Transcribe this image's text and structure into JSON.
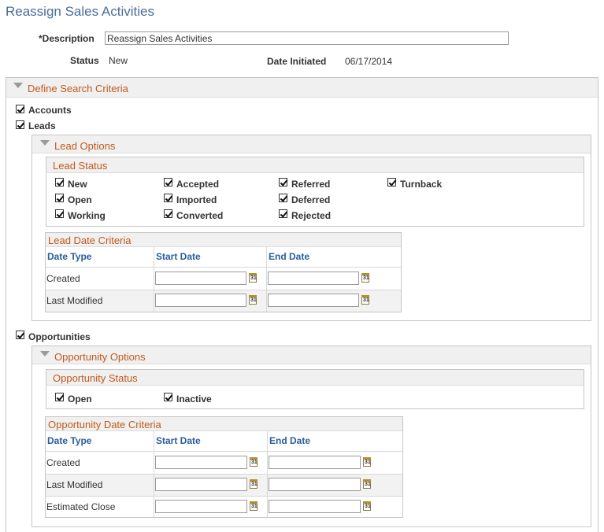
{
  "page": {
    "title": "Reassign Sales Activities",
    "description_label": "*Description",
    "description_value": "Reassign Sales Activities",
    "status_label": "Status",
    "status_value": "New",
    "date_initiated_label": "Date Initiated",
    "date_initiated_value": "06/17/2014"
  },
  "search_criteria": {
    "title": "Define Search Criteria",
    "accounts_label": "Accounts",
    "leads_label": "Leads",
    "opportunities_label": "Opportunities"
  },
  "lead_options": {
    "title": "Lead Options",
    "status_title": "Lead Status",
    "statuses": [
      "New",
      "Accepted",
      "Referred",
      "Turnback",
      "Open",
      "Imported",
      "Deferred",
      "Working",
      "Converted",
      "Rejected"
    ],
    "date_title": "Lead Date Criteria",
    "columns": [
      "Date Type",
      "Start Date",
      "End Date"
    ],
    "rows": [
      "Created",
      "Last Modified"
    ]
  },
  "opportunity_options": {
    "title": "Opportunity Options",
    "status_title": "Opportunity Status",
    "statuses": [
      "Open",
      "Inactive"
    ],
    "date_title": "Opportunity Date Criteria",
    "columns": [
      "Date Type",
      "Start Date",
      "End Date"
    ],
    "rows": [
      "Created",
      "Last Modified",
      "Estimated Close"
    ]
  },
  "calendar_icon_text": "31",
  "colors": {
    "title_blue": "#4a6e98",
    "section_orange": "#c05a1a",
    "column_navy": "#2a5d9c"
  }
}
